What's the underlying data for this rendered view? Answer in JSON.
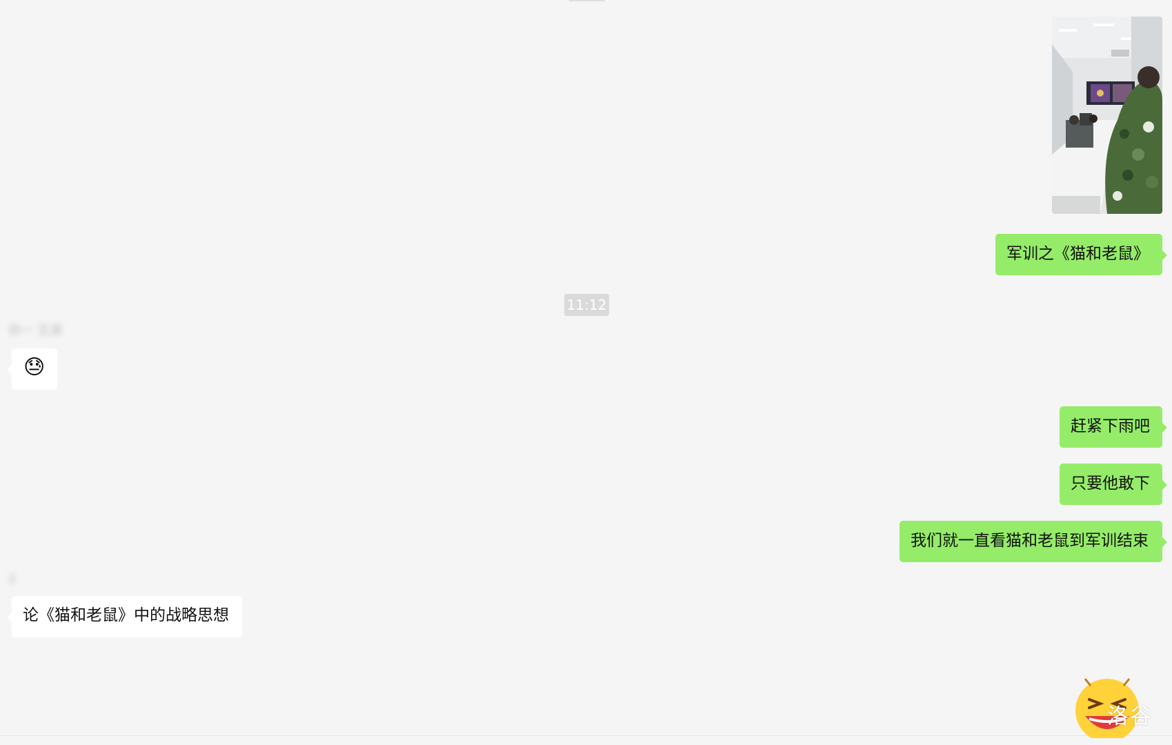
{
  "messages": {
    "sent_caption": "军训之《猫和老鼠》",
    "time_divider": "11:12",
    "sender_1_name": "彷一  王淚",
    "sender_1_emoji": "😓",
    "sent_1": "赶紧下雨吧",
    "sent_2": "只要他敢下",
    "sent_3": "我们就一直看猫和老鼠到军训结束",
    "sender_2_name": "2",
    "sender_2_text": "论《猫和老鼠》中的战略思想"
  },
  "watermark": {
    "text": "洛谷"
  },
  "colors": {
    "background": "#f5f5f5",
    "sent_bubble": "#95ec69",
    "received_bubble": "#ffffff",
    "timestamp_badge": "#dadada"
  }
}
